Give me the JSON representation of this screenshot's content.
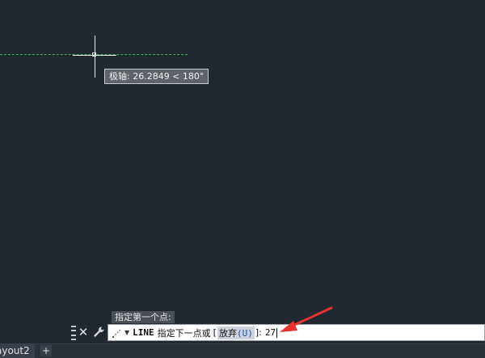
{
  "drawing": {
    "polar_tooltip": "极轴: 26.2849 < 180°"
  },
  "command": {
    "history_prompt": "指定第一个点:",
    "name": "LINE",
    "prompt_text": "指定下一点或",
    "bracket_open": "[",
    "option_label": "放弃",
    "option_key": "(U)",
    "bracket_close": "]:",
    "input_value": "27"
  },
  "tabs": {
    "layout_tab": "ayout2",
    "add_tab": "+"
  },
  "icons": {
    "close": "close-icon",
    "settings": "wrench-icon",
    "command_line": "line-command-icon",
    "dropdown": "chevron-down-icon",
    "grip": "grip-icon"
  },
  "colors": {
    "canvas_bg": "#212830",
    "polar_tracking": "#3fb05a",
    "annotation_arrow": "#e8322b"
  }
}
